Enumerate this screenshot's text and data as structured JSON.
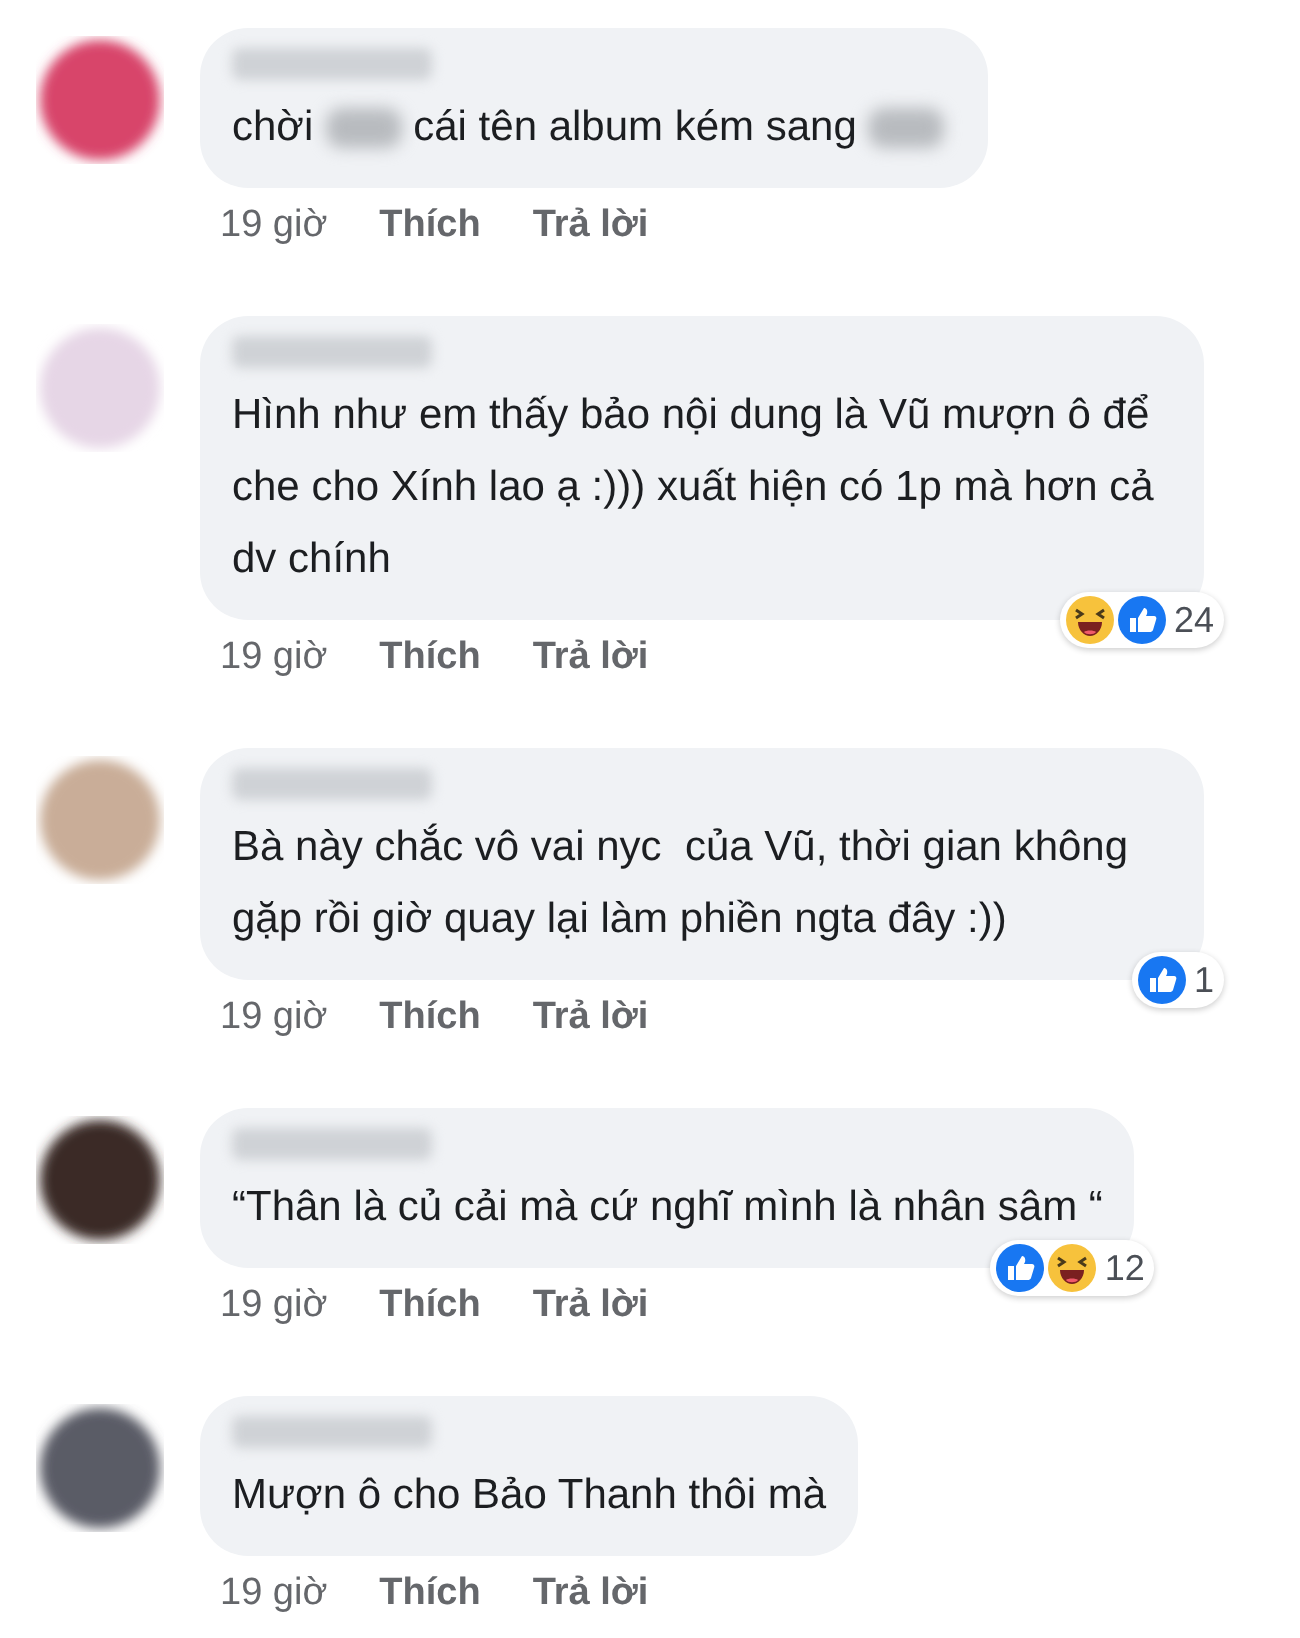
{
  "comments": [
    {
      "color": "#d8456a",
      "parts": [
        {
          "kind": "text",
          "text": "chời"
        },
        {
          "kind": "blur"
        },
        {
          "kind": "text",
          "text": "cái tên album kém sang"
        },
        {
          "kind": "blur"
        }
      ],
      "time": "19 giờ",
      "like": "Thích",
      "reply": "Trả lời"
    },
    {
      "color": "#e6d6e6",
      "parts": [
        {
          "kind": "text",
          "text": "Hình như em thấy bảo nội dung là Vũ mượn ô để che cho Xính lao ạ :))) xuất hiện có 1p mà hơn cả dv chính"
        }
      ],
      "time": "19 giờ",
      "like": "Thích",
      "reply": "Trả lời",
      "reactions": [
        {
          "kind": "haha"
        },
        {
          "kind": "like"
        }
      ],
      "reaction_count": "24"
    },
    {
      "color": "#c9ad98",
      "parts": [
        {
          "kind": "text",
          "text": "Bà này chắc vô vai nyc  của Vũ, thời gian không gặp rồi giờ quay lại làm phiền ngta đây :))"
        }
      ],
      "time": "19 giờ",
      "like": "Thích",
      "reply": "Trả lời",
      "reactions": [
        {
          "kind": "like"
        }
      ],
      "reaction_count": "1"
    },
    {
      "color": "#3a2a26",
      "parts": [
        {
          "kind": "text",
          "text": "“Thân là củ cải mà cứ nghĩ mình là nhân sâm “"
        }
      ],
      "time": "19 giờ",
      "like": "Thích",
      "reply": "Trả lời",
      "reactions": [
        {
          "kind": "like"
        },
        {
          "kind": "haha"
        }
      ],
      "reaction_count": "12"
    },
    {
      "color": "#5a5c66",
      "parts": [
        {
          "kind": "text",
          "text": "Mượn ô cho Bảo Thanh thôi mà"
        }
      ],
      "time": "19 giờ",
      "like": "Thích",
      "reply": "Trả lời"
    }
  ]
}
